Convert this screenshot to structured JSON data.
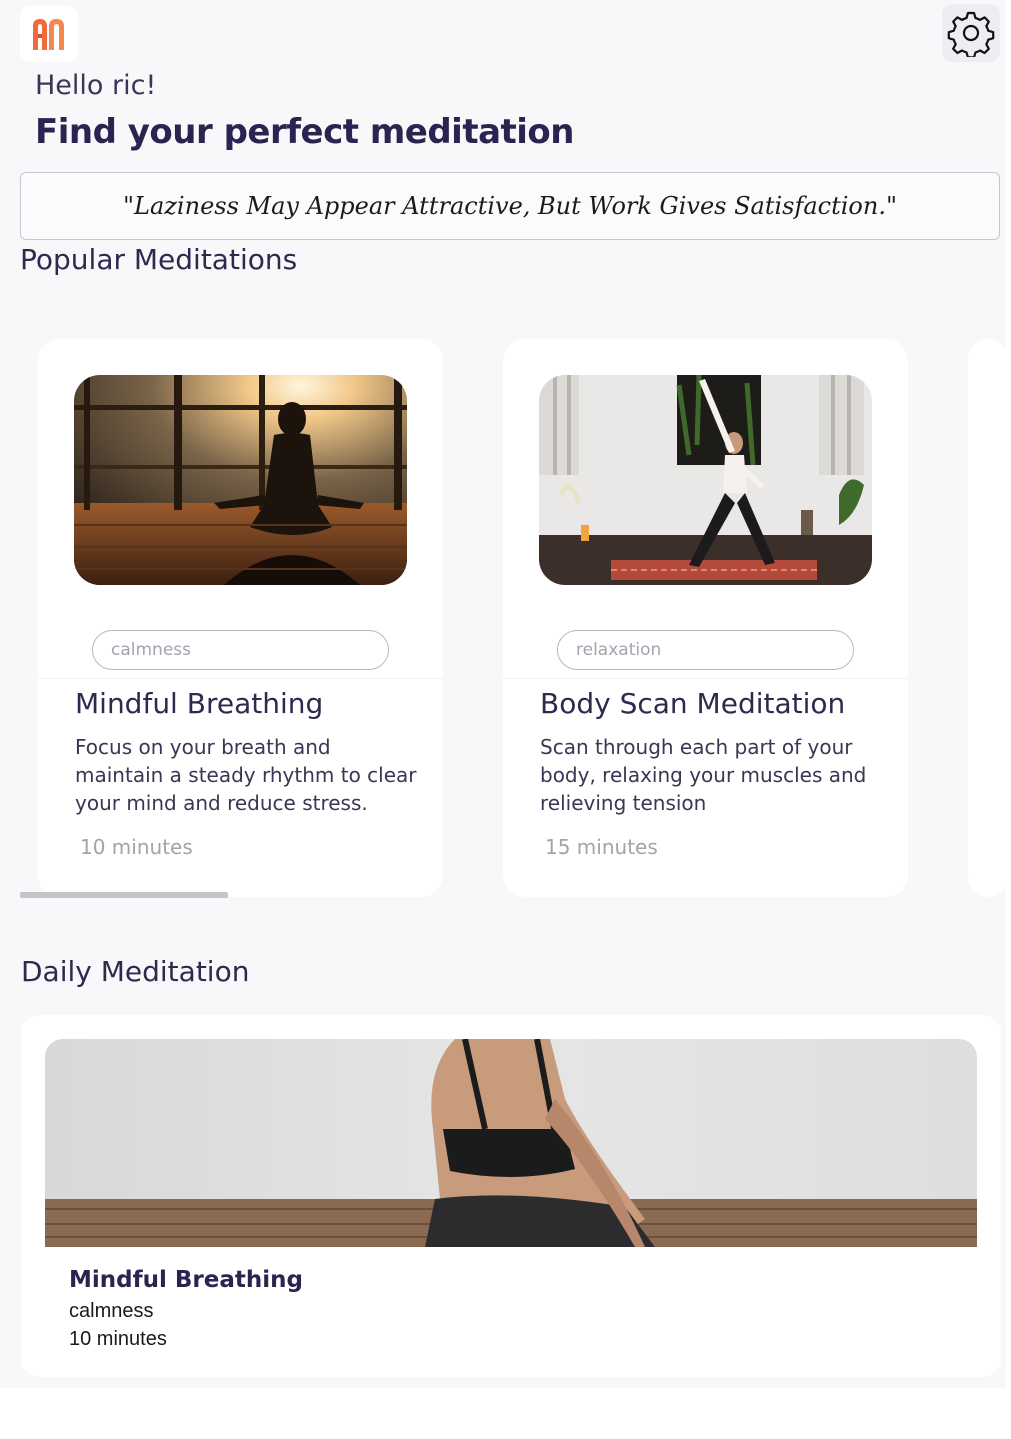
{
  "header": {
    "logo_icon": "brand-logo-icon",
    "settings_icon": "gear-icon",
    "greeting": "Hello ric!",
    "headline": "Find your perfect meditation"
  },
  "quote": "\"Laziness May Appear Attractive, But Work Gives Satisfaction.\"",
  "popular": {
    "title": "Popular Meditations",
    "cards": [
      {
        "image": "silhouette-meditation-photo",
        "tag": "calmness",
        "title": "Mindful Breathing",
        "description": "Focus on your breath and maintain a steady rhythm to clear your mind and reduce stress.",
        "duration": "10 minutes"
      },
      {
        "image": "yoga-pose-photo",
        "tag": "relaxation",
        "title": "Body Scan Meditation",
        "description": "Scan through each part of your body, relaxing your muscles and relieving tension",
        "duration": "15 minutes"
      }
    ]
  },
  "daily": {
    "title": "Daily Meditation",
    "image": "seated-woman-photo",
    "name": "Mindful Breathing",
    "category": "calmness",
    "duration": "10 minutes"
  },
  "colors": {
    "background": "#f8f8fb",
    "primary_text": "#2b2450",
    "muted_text": "#a3a3ad",
    "logo_orange": "#f06a3b"
  }
}
